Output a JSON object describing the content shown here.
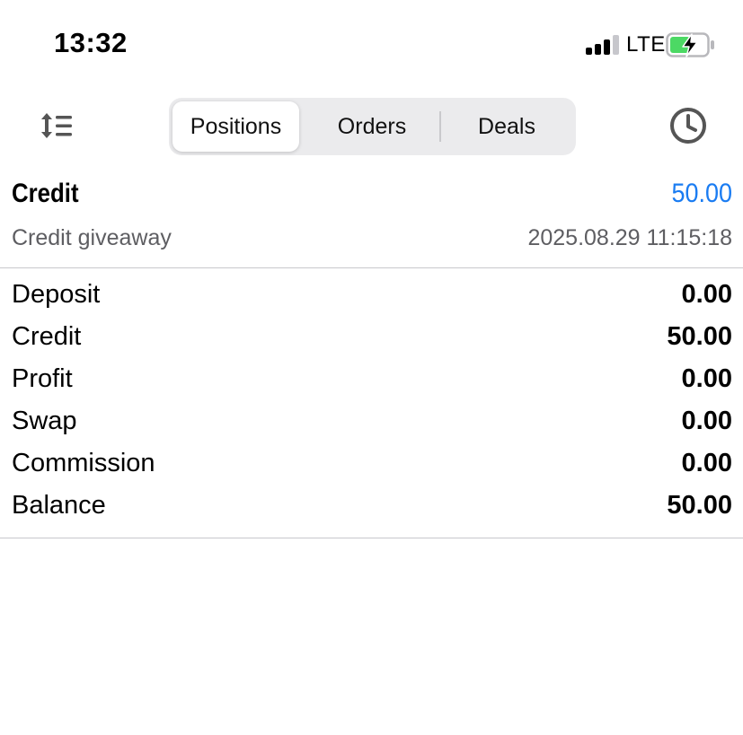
{
  "status_bar": {
    "time": "13:32",
    "network": "LTE",
    "signal_icon": "signal-bars-icon",
    "battery_icon": "battery-charging-icon",
    "battery_color": "#4cd964"
  },
  "toolbar": {
    "sort_icon": "sort-list-icon",
    "history_icon": "clock-icon",
    "tabs": [
      {
        "label": "Positions",
        "active": true
      },
      {
        "label": "Orders",
        "active": false
      },
      {
        "label": "Deals",
        "active": false
      }
    ]
  },
  "deal": {
    "type": "Credit",
    "amount": "50.00",
    "comment": "Credit giveaway",
    "time": "2025.08.29 11:15:18",
    "amount_color": "#1a7cf2"
  },
  "summary": [
    {
      "label": "Deposit",
      "value": "0.00"
    },
    {
      "label": "Credit",
      "value": "50.00"
    },
    {
      "label": "Profit",
      "value": "0.00"
    },
    {
      "label": "Swap",
      "value": "0.00"
    },
    {
      "label": "Commission",
      "value": "0.00"
    },
    {
      "label": "Balance",
      "value": "50.00"
    }
  ]
}
